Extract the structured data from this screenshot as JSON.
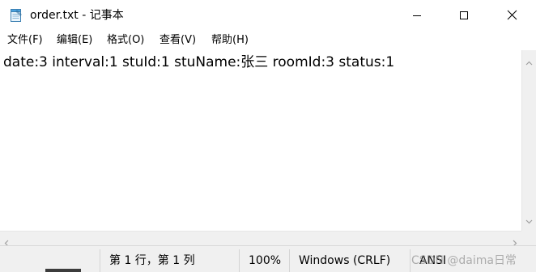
{
  "window": {
    "title": "order.txt - 记事本",
    "icon": "notepad-icon",
    "controls": [
      "minimize-icon",
      "maximize-icon",
      "close-icon"
    ]
  },
  "menu": {
    "file": "文件(F)",
    "edit": "编辑(E)",
    "format": "格式(O)",
    "view": "查看(V)",
    "help": "帮助(H)"
  },
  "editor": {
    "content": "date:3 interval:1 stuId:1 stuName:张三 roomId:3 status:1"
  },
  "status": {
    "position": "第 1 行，第 1 列",
    "zoom": "100%",
    "line_ending": "Windows (CRLF)",
    "encoding": "ANSI"
  },
  "watermark": {
    "text": "CSDN @daima日常"
  }
}
